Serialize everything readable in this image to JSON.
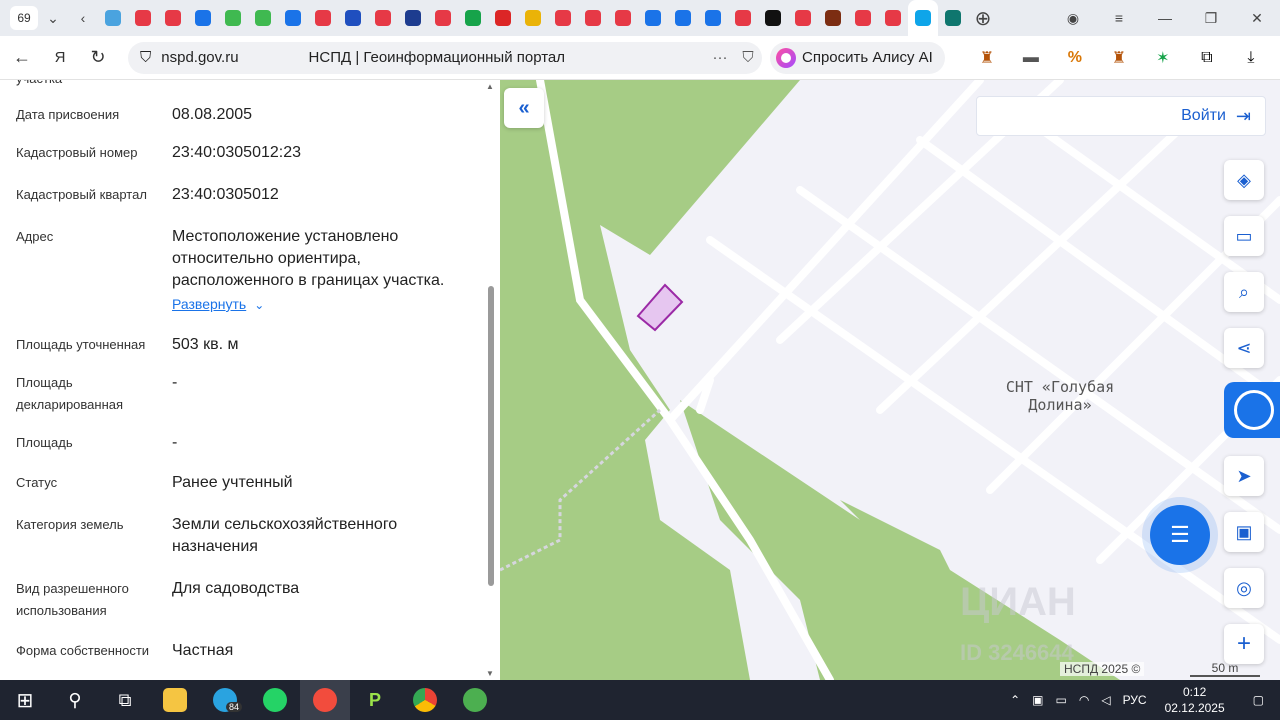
{
  "browser": {
    "tab_count": "69",
    "url_domain": "nspd.gov.ru",
    "page_title": "НСПД | Геоинформационный портал",
    "alice_label": "Спросить Алису AI"
  },
  "favicons": [
    "#4aa3df",
    "#e63946",
    "#e63946",
    "#1a73e8",
    "#3fb950",
    "#3fb950",
    "#1a73e8",
    "#e63946",
    "#1f4fbf",
    "#e63946",
    "#1d3c8f",
    "#e63946",
    "#16a34a",
    "#dc2626",
    "#eab308",
    "#e63946",
    "#e63946",
    "#e63946",
    "#1a73e8",
    "#1a73e8",
    "#1a73e8",
    "#e63946",
    "#111111",
    "#e63946",
    "#7c2d12",
    "#e63946",
    "#e63946",
    "#0ea5e9",
    "#0f766e"
  ],
  "panel": {
    "partial_label": "участка",
    "rows": [
      {
        "label": "Дата присвоения",
        "value": "08.08.2005"
      },
      {
        "label": "Кадастровый номер",
        "value": "23:40:0305012:23"
      },
      {
        "label": "Кадастровый квартал",
        "value": "23:40:0305012"
      },
      {
        "label": "Адрес",
        "value": "Местоположение установлено относительно ориентира, расположенного в границах участка."
      },
      {
        "label": "Площадь уточненная",
        "value": "503 кв. м"
      },
      {
        "label": "Площадь декларированная",
        "value": "-"
      },
      {
        "label": "Площадь",
        "value": "-"
      },
      {
        "label": "Статус",
        "value": "Ранее учтенный"
      },
      {
        "label": "Категория земель",
        "value": "Земли сельскохозяйственного назначения"
      },
      {
        "label": "Вид разрешенного использования",
        "value": "Для садоводства"
      },
      {
        "label": "Форма собственности",
        "value": "Частная"
      }
    ],
    "expand_label": "Развернуть"
  },
  "map": {
    "login_label": "Войти",
    "snt_label": "СНТ «Голубая Долина»",
    "attribution": "НСПД 2025 ©",
    "scale_label": "50 m",
    "watermark": "ЦИАН",
    "watermark_id": "ID 3246644",
    "colors": {
      "forest": "#a6cc85",
      "land": "#f2f2f8",
      "road": "#ffffff",
      "parcel_fill": "#e6c6f0",
      "parcel_stroke": "#9b2aa6",
      "accent": "#1a5fd0"
    }
  },
  "taskbar": {
    "lang": "РУС",
    "time": "0:12",
    "date": "02.12.2025",
    "telegram_badge": "84"
  }
}
